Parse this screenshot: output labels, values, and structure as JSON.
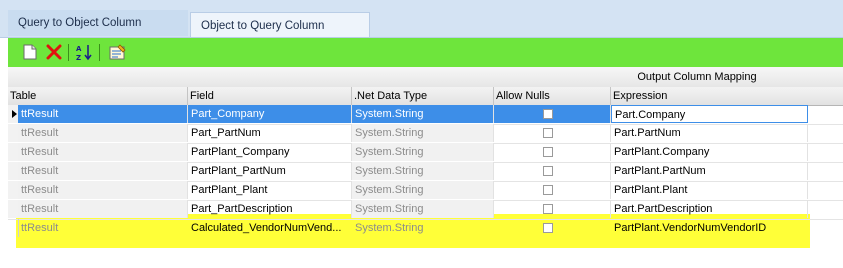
{
  "tabs": [
    {
      "label": "Query to Object Column Mapping",
      "active": false
    },
    {
      "label": "Object to Query Column Mapping",
      "active": true
    }
  ],
  "toolbar": {
    "buttons": [
      {
        "name": "new-icon"
      },
      {
        "name": "delete-icon"
      },
      {
        "name": "sort-az-icon"
      },
      {
        "name": "edit-list-icon"
      }
    ],
    "background_color": "#6ee53c"
  },
  "grid": {
    "band_label": "Output Column Mapping",
    "columns": [
      "Table",
      "Field",
      ".Net Data Type",
      "Allow Nulls",
      "Expression"
    ],
    "rows": [
      {
        "table": "ttResult",
        "field": "Part_Company",
        "type": "System.String",
        "allow_nulls": false,
        "expression": "Part.Company",
        "selected": true
      },
      {
        "table": "ttResult",
        "field": "Part_PartNum",
        "type": "System.String",
        "allow_nulls": false,
        "expression": "Part.PartNum",
        "selected": false
      },
      {
        "table": "ttResult",
        "field": "PartPlant_Company",
        "type": "System.String",
        "allow_nulls": false,
        "expression": "PartPlant.Company",
        "selected": false
      },
      {
        "table": "ttResult",
        "field": "PartPlant_PartNum",
        "type": "System.String",
        "allow_nulls": false,
        "expression": "PartPlant.PartNum",
        "selected": false
      },
      {
        "table": "ttResult",
        "field": "PartPlant_Plant",
        "type": "System.String",
        "allow_nulls": false,
        "expression": "PartPlant.Plant",
        "selected": false
      },
      {
        "table": "ttResult",
        "field": "Part_PartDescription",
        "type": "System.String",
        "allow_nulls": false,
        "expression": "Part.PartDescription",
        "selected": false
      },
      {
        "table": "ttResult",
        "field": "Calculated_VendorNumVend...",
        "type": "System.String",
        "allow_nulls": false,
        "expression": "PartPlant.VendorNumVendorID",
        "selected": false,
        "highlighted": true
      }
    ]
  },
  "colors": {
    "selection": "#3d8ee8",
    "highlight": "#ffff00",
    "tab_strip": "#d4e3f3"
  }
}
